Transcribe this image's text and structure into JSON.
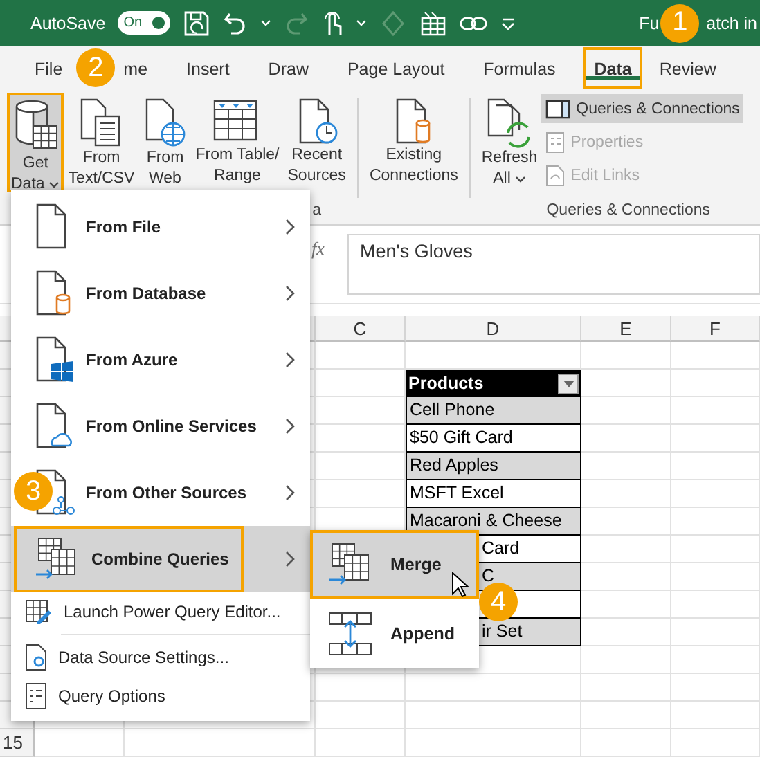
{
  "title_bar": {
    "autosave_label": "AutoSave",
    "autosave_toggle": {
      "label": "On",
      "on": true
    },
    "title_parts": [
      "Fu",
      "atch in"
    ]
  },
  "tabs": [
    {
      "label": "File",
      "selected": false
    },
    {
      "label": "me",
      "selected": false
    },
    {
      "label": "Insert",
      "selected": false
    },
    {
      "label": "Draw",
      "selected": false
    },
    {
      "label": "Page Layout",
      "selected": false
    },
    {
      "label": "Formulas",
      "selected": false
    },
    {
      "label": "Data",
      "selected": true
    },
    {
      "label": "Review",
      "selected": false
    }
  ],
  "ribbon": {
    "large_buttons": [
      {
        "lines": [
          "Get",
          "Data"
        ],
        "dropdown": true,
        "selected": true
      },
      {
        "lines": [
          "From",
          "Text/CSV"
        ],
        "dropdown": false,
        "selected": false
      },
      {
        "lines": [
          "From",
          "Web"
        ],
        "dropdown": false,
        "selected": false
      },
      {
        "lines": [
          "From Table/",
          "Range"
        ],
        "dropdown": false,
        "selected": false
      },
      {
        "lines": [
          "Recent",
          "Sources"
        ],
        "dropdown": false,
        "selected": false
      },
      {
        "lines": [
          "Existing",
          "Connections"
        ],
        "dropdown": false,
        "selected": false
      },
      {
        "lines": [
          "Refresh",
          "All"
        ],
        "dropdown": true,
        "selected": false
      }
    ],
    "small_buttons": [
      {
        "label": "Queries & Connections",
        "selected": true,
        "disabled": false
      },
      {
        "label": "Properties",
        "selected": false,
        "disabled": true
      },
      {
        "label": "Edit Links",
        "selected": false,
        "disabled": true
      }
    ],
    "group_labels": [
      "a",
      "Queries & Connections"
    ]
  },
  "formula_bar": {
    "function_label": "fx",
    "value": "Men's Gloves"
  },
  "sheet": {
    "columns": [
      "C",
      "D",
      "E",
      "F"
    ],
    "row_number": "15",
    "table": {
      "header": "Products",
      "rows": [
        {
          "text": "Cell Phone",
          "covered": false
        },
        {
          "text": "$50 Gift Card",
          "covered": false
        },
        {
          "text": "Red Apples",
          "covered": false
        },
        {
          "text": "MSFT Excel",
          "covered": false
        },
        {
          "text": "Macaroni & Cheese",
          "covered": false
        },
        {
          "text": "Card",
          "covered": true
        },
        {
          "text": "C",
          "covered": true
        },
        {},
        {
          "text": "ir Set",
          "covered": true
        }
      ]
    }
  },
  "get_data_menu": {
    "items": [
      {
        "label": "From File",
        "bold": true,
        "submenu": true,
        "selected": false
      },
      {
        "label": "From Database",
        "bold": true,
        "submenu": true,
        "selected": false
      },
      {
        "label": "From Azure",
        "bold": true,
        "submenu": true,
        "selected": false
      },
      {
        "label": "From Online Services",
        "bold": true,
        "submenu": true,
        "selected": false
      },
      {
        "label": "From Other Sources",
        "bold": true,
        "submenu": true,
        "selected": false
      },
      {
        "label": "Combine Queries",
        "bold": true,
        "submenu": true,
        "selected": true
      },
      {
        "label": "Launch Power Query Editor...",
        "bold": false,
        "submenu": false,
        "selected": false
      },
      {
        "label": "Data Source Settings...",
        "bold": false,
        "submenu": false,
        "selected": false
      },
      {
        "label": "Query Options",
        "bold": false,
        "submenu": false,
        "selected": false
      }
    ]
  },
  "combine_submenu": {
    "items": [
      {
        "label": "Merge",
        "selected": true
      },
      {
        "label": "Append",
        "selected": false
      }
    ]
  },
  "callouts": [
    "1",
    "2",
    "3",
    "4"
  ]
}
